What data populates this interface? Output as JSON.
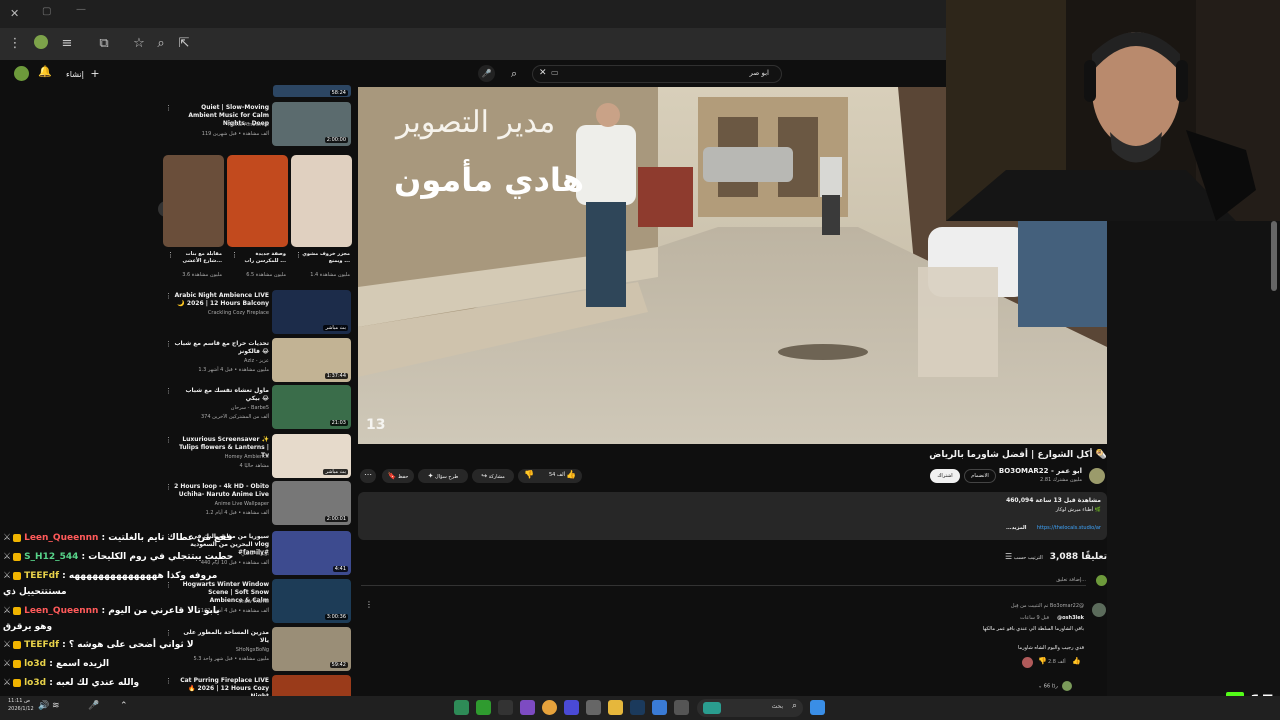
{
  "search": {
    "query": "ابو صر"
  },
  "header": {
    "create_label": "إنشاء"
  },
  "video": {
    "overlay_line1": "مدير التصوير",
    "overlay_line2": "هادي مأمون",
    "watermark": "13",
    "title": "أكل الشوارع | أفضل شاورما بالرياض 🌯",
    "channel": "BO3OMAR22 - ابو عمر",
    "subs": "2.81 مليون مشترك",
    "join_label": "الانضمام",
    "subscribe_label": "اشتراك",
    "likes": "54 ألف",
    "share_label": "مشاركة",
    "ask_label": "طرح سؤال",
    "save_label": "حفظ",
    "views": "460,094 مشاهدة قبل 13 ساعة",
    "desc_line": "أطباء ميرش لوكار 🌿",
    "desc_link": "https://thelocals.studio/ar",
    "more": "...المزيد"
  },
  "comments": {
    "count": "3,088 تعليقًا",
    "sort_label": "الترتيب حسب",
    "add_placeholder": "إضافة تعليق...",
    "pinned": "تم التثبيت من قِبل Bo3omar22@",
    "author": "@osh3lek",
    "time": "قبل 9 ساعات",
    "line1": "باقي الشاورما السلطة الي عندي باقو عمر مالكها",
    "line2": "قدي رجيب والبوم الشاه شاورما",
    "likes": "2.8 ألف",
    "replies": "66 ردًا"
  },
  "sidebar": [
    {
      "title": "Quiet | Slow-Moving Ambient Music for Calm Nights - Deep",
      "channel": "Astral Ambience",
      "meta": "119 ألف مشاهدة • قبل شهرين",
      "duration": "2:00:00",
      "thumb": "#5b6b6e"
    },
    {
      "title": "Arabic Night Ambience LIVE 🌙 2026 | 12 Hours Balcony",
      "channel": "Crackling Cozy Fireplace",
      "meta": "",
      "duration": "بث مباشر",
      "thumb": "#1c2c4a"
    },
    {
      "title": "تحديات حراج مع قاسم مع شباب فالكونز 😂",
      "channel": "Aziz - عزيز",
      "meta": "1.3 مليون مشاهدة • قبل 4 أشهر",
      "duration": "1:37:44",
      "thumb": "#c2b394"
    },
    {
      "title": "ماول تعشاه تفسك مع شباب بيكي 😂",
      "channel": "سرحان - Barbe5",
      "meta": "374 ألف من المشتركين الآخرين",
      "duration": "21:03",
      "thumb": "#3a6d4a"
    },
    {
      "title": "Luxurious Screensaver ✨ Tulips flowers & Lanterns | Tv",
      "channel": "Homey Ambience",
      "meta": "4 مشاهد حاليًا",
      "duration": "بث مباشر",
      "thumb": "#e6dacb"
    },
    {
      "title": "2 Hours loop - 4k HD - Obito Uchiha- Naruto Anime Live",
      "channel": "Anime Live Wallpaper",
      "meta": "1.2 ألف مشاهدة • قبل 4 أيام",
      "duration": "2:00:01",
      "thumb": "#777"
    },
    {
      "title": "سيوريا من مطعم البك في البحرين من السعودية vlog #family#",
      "channel": "بوبيات عائلتي",
      "meta": "440 ألف مشاهدة • قبل 10 أيام",
      "duration": "4:41",
      "thumb": "#3d4b8f"
    },
    {
      "title": "Hogwarts Winter Window Scene | Soft Snow Ambience & Calm",
      "channel": "Snow Frame",
      "meta": "142 ألف مشاهدة • قبل 4 أشهر",
      "duration": "3:00:36",
      "thumb": "#1d3c57"
    },
    {
      "title": "مدرين المساحة بالمطور على يالا",
      "channel": "SHoNgxBoNg",
      "meta": "5.3 مليون مشاهدة • قبل شهر واحد",
      "duration": "59:42",
      "thumb": "#9a8e77"
    },
    {
      "title": "Cat Purring Fireplace LIVE 🔥 2026 | 12 Hours Cozy Night",
      "channel": "",
      "meta": "",
      "duration": "",
      "thumb": "#9a3b1a"
    }
  ],
  "shorts": [
    {
      "title": "مجزر خروف مشوي ويمنع ...",
      "views": "1.4 مليون مشاهدة",
      "thumb": "#e0d0c0"
    },
    {
      "title": "وصفة جديدة للمكرسن راب ...",
      "views": "6.5 مليون مشاهدة",
      "thumb": "#c24a1e"
    },
    {
      "title": "مقابلة مع بنات شارع الأعشى...",
      "views": "3.6 مليون مشاهدة",
      "thumb": "#6a4e3a"
    }
  ],
  "chat": [
    {
      "user": "Leen_Queennn",
      "msg": "فقع من عطاك تايم بالغلتيت"
    },
    {
      "user": "S_H12_544",
      "msg": "حطيت يبتتجلي في روم الكليحات"
    },
    {
      "user": "TEEFdf",
      "msg": "مروفه وكذا هههههههههههههههه"
    },
    {
      "user": "",
      "msg": "مستتتحييل ذي"
    },
    {
      "user": "Leen_Queennn",
      "msg": "يابو تالا قاعرني من اليوم"
    },
    {
      "user": "",
      "msg": "وهو يرقرق"
    },
    {
      "user": "TEEFdf",
      "msg": "لا ثواني أضحى على هوشه ؟"
    },
    {
      "user": "lo3d",
      "msg": "الزيده اسمع"
    },
    {
      "user": "lo3d",
      "msg": "والله عندي لك لعبه"
    }
  ],
  "kick": {
    "count": "17"
  },
  "taskbar": {
    "search_label": "بحث",
    "time": "11:11 ص",
    "date": "2026/1/12"
  },
  "colors": {
    "accent": "#3ea6ff",
    "subscribe": "#f1f1f1",
    "kick": "#53fc18"
  }
}
